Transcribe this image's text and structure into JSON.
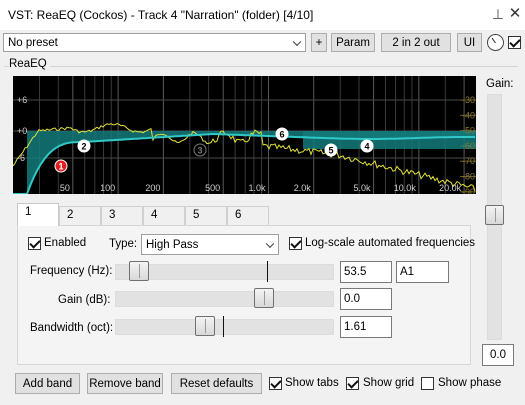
{
  "window": {
    "title": "VST: ReaEQ (Cockos) - Track 4 \"Narration\" (folder) [4/10]",
    "pin_glyph": "⊥",
    "close_glyph": "✕"
  },
  "toolbar": {
    "preset_value": "No preset",
    "plus_label": "+",
    "param_label": "Param",
    "io_label": "2 in 2 out",
    "ui_label": "UI"
  },
  "group_label": "ReaEQ",
  "gain": {
    "label": "Gain:",
    "value": "0.0",
    "level_fraction": 0.51
  },
  "graph": {
    "db_labels_left": [
      "+6",
      "+0",
      "-6"
    ],
    "db_labels_right": [
      "-30",
      "-40",
      "-50",
      "-60",
      "-70",
      "-80",
      "-90"
    ],
    "freq_labels": [
      "50",
      "100",
      "200",
      "500",
      "1.0k",
      "2.0k",
      "5.0k",
      "10.0k",
      "20.0k"
    ],
    "band_markers": [
      "1",
      "2",
      "3",
      "4",
      "5",
      "6"
    ],
    "colors": {
      "background": "#000000",
      "response_curve": "#30c8c8",
      "response_fill": "#137a7a",
      "spectrum": "#e2e23a",
      "grid": "#3a3a3a",
      "band1_marker": "#e02020"
    }
  },
  "tabs": [
    "1",
    "2",
    "3",
    "4",
    "5",
    "6"
  ],
  "active_tab": "1",
  "band": {
    "enabled_label": "Enabled",
    "enabled_checked": true,
    "type_label": "Type:",
    "type_value": "High Pass",
    "logscale_label": "Log-scale automated frequencies",
    "logscale_checked": true,
    "frequency": {
      "label": "Frequency (Hz):",
      "value": "53.5",
      "note": "A1",
      "level_fraction": 0.06
    },
    "gain": {
      "label": "Gain (dB):",
      "value": "0.0",
      "level_fraction": 0.7
    },
    "bandwidth": {
      "label": "Bandwidth (oct):",
      "value": "1.61",
      "level_fraction": 0.4
    }
  },
  "bottom": {
    "add_band": "Add band",
    "remove_band": "Remove band",
    "reset_defaults": "Reset defaults",
    "show_tabs": "Show tabs",
    "show_tabs_checked": true,
    "show_grid": "Show grid",
    "show_grid_checked": true,
    "show_phase": "Show phase",
    "show_phase_checked": false
  }
}
